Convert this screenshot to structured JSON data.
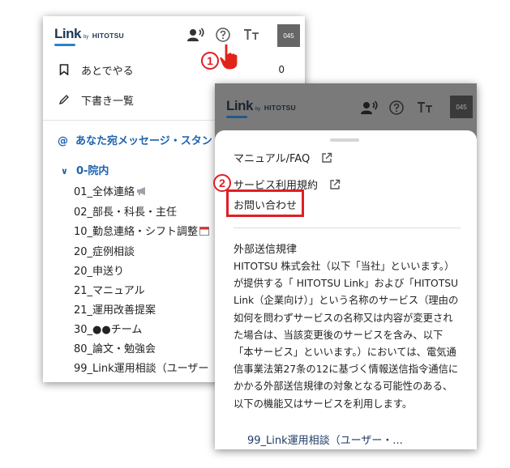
{
  "brand": {
    "name": "Link",
    "by": "by",
    "company": "HITOTSU",
    "accent": "#2f80c8",
    "text": "#1d3557"
  },
  "header": {
    "user_badge": "045",
    "icons": [
      "contacts-icon",
      "help-icon",
      "text-size-icon"
    ]
  },
  "panel1": {
    "later": {
      "label": "あとでやる",
      "count": "0"
    },
    "drafts": {
      "label": "下書き一覧"
    },
    "mentions": {
      "label": "あなた宛メッセージ・スタン"
    },
    "group": {
      "label": "0-院内"
    },
    "channels": [
      "01_全体連絡",
      "02_部長・科長・主任",
      "10_勤怠連絡・シフト調整",
      "20_症例相談",
      "20_申送り",
      "21_マニュアル",
      "21_運用改善提案",
      "30_●●チーム",
      "80_論文・勉強会",
      "99_Link運用相談（ユーザー"
    ]
  },
  "panel2": {
    "menu": {
      "manual": "マニュアル/FAQ",
      "terms": "サービス利用規約",
      "contact": "お問い合わせ"
    },
    "regulation_title": "外部送信規律",
    "regulation_text": "HITOTSU 株式会社（以下「当社」といいます。）が提供する「 HITOTSU Link」および「HITOTSU Link（企業向け）」という名称のサービス（理由の如何を問わずサービスの名称又は内容が変更された場合は、当該変更後のサービスを含み、以下「本サービス」といいます。）においては、電気通信事業法第27条の12に基づく情報送信指令通信にかかる外部送信規律の対象となる可能性のある、以下の機能又はサービスを利用します。",
    "bottom_channel": "99_Link運用相談（ユーザー・..."
  },
  "annotations": {
    "step1": "1",
    "step2": "2",
    "highlight_color": "#e01e26"
  }
}
